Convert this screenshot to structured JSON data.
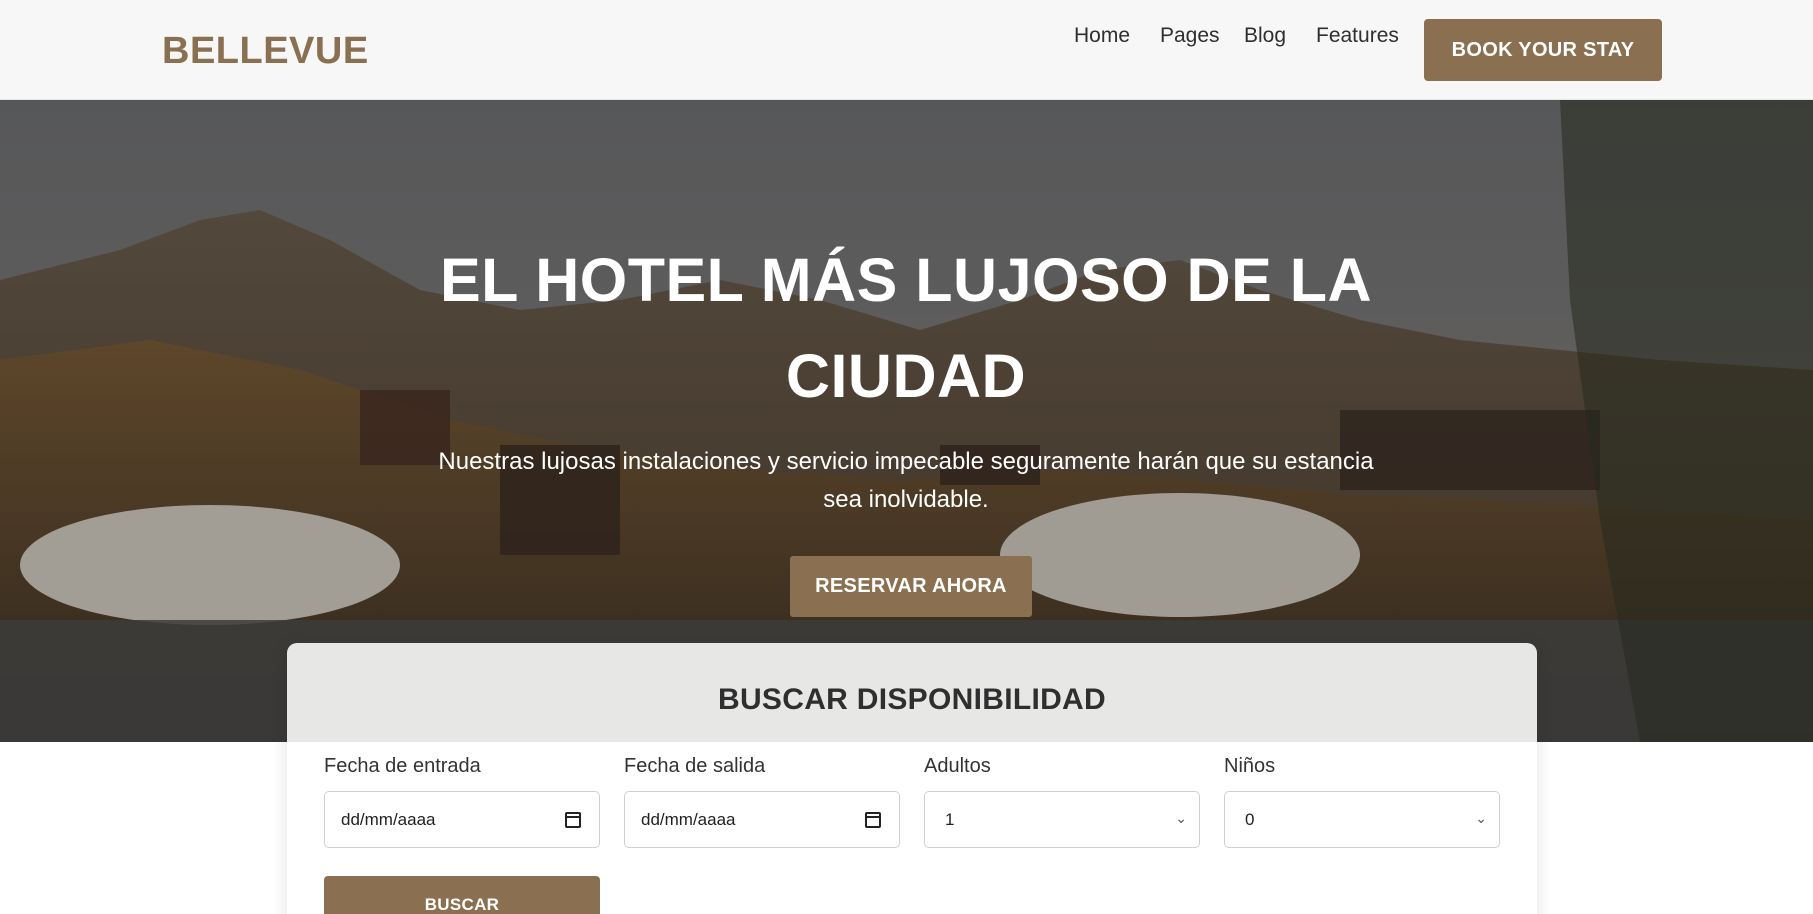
{
  "header": {
    "logo": "BELLEVUE",
    "nav": [
      {
        "label": "Home"
      },
      {
        "label": "Pages"
      },
      {
        "label": "Blog"
      },
      {
        "label": "Features"
      }
    ],
    "book_button": "BOOK YOUR STAY"
  },
  "hero": {
    "title": "EL HOTEL MÁS LUJOSO DE LA CIUDAD",
    "subtitle": "Nuestras lujosas instalaciones y servicio impecable seguramente harán que su estancia sea inolvidable.",
    "cta": "RESERVAR AHORA"
  },
  "search": {
    "title": "BUSCAR DISPONIBILIDAD",
    "fields": [
      {
        "label": "Fecha de entrada",
        "value": "dd/mm/aaaa",
        "type": "date"
      },
      {
        "label": "Fecha de salida",
        "value": "dd/mm/aaaa",
        "type": "date"
      },
      {
        "label": "Adultos",
        "value": "1",
        "type": "select"
      },
      {
        "label": "Niños",
        "value": "0",
        "type": "select"
      }
    ],
    "button": "BUSCAR"
  },
  "colors": {
    "brand": "#8a7050",
    "header_bg": "#f7f7f7",
    "text_dark": "#2f2f2f"
  }
}
